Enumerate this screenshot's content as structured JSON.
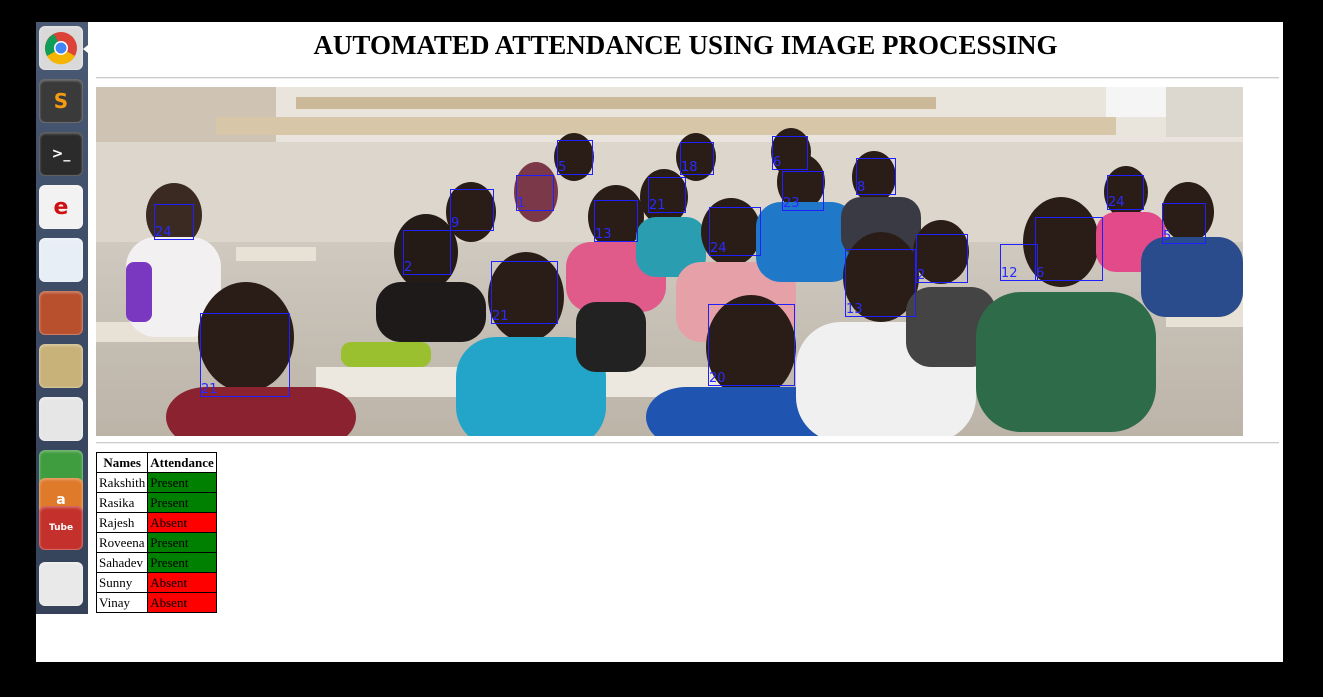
{
  "page": {
    "title": "AUTOMATED ATTENDANCE USING IMAGE PROCESSING"
  },
  "launcher": {
    "items": [
      {
        "name": "chrome-icon",
        "color": "#d9d9d9"
      },
      {
        "name": "sublime-text-icon",
        "label": "S",
        "color": "#3a3a3a"
      },
      {
        "name": "terminal-icon",
        "label": ">_",
        "color": "#2b2b2b"
      },
      {
        "name": "ubuntu-one-icon",
        "label": "e",
        "color": "#f2f2f2"
      },
      {
        "name": "image-viewer-icon",
        "color": "#e8eef6"
      },
      {
        "name": "files-icon",
        "color": "#b8502e"
      },
      {
        "name": "photo-tool-icon",
        "color": "#c9b27a"
      },
      {
        "name": "text-editor-icon",
        "color": "#e6e6e6"
      },
      {
        "name": "spreadsheet-icon",
        "color": "#3f9c3f"
      },
      {
        "name": "software-center-icon",
        "label": "a",
        "color": "#e07a2b"
      },
      {
        "name": "youtube-icon",
        "label": "Tube",
        "color": "#c4302b"
      },
      {
        "name": "gmail-icon",
        "color": "#e9e9e9"
      }
    ]
  },
  "detections": [
    "24",
    "21",
    "5",
    "9",
    "1",
    "2",
    "13",
    "18",
    "21",
    "6",
    "23",
    "24",
    "8",
    "13",
    "2",
    "12",
    "6",
    "24",
    "5",
    "20",
    "21"
  ],
  "table": {
    "headers": [
      "Names",
      "Attendance"
    ],
    "rows": [
      {
        "name": "Rakshith",
        "status": "Present"
      },
      {
        "name": "Rasika",
        "status": "Present"
      },
      {
        "name": "Rajesh",
        "status": "Absent"
      },
      {
        "name": "Roveena",
        "status": "Present"
      },
      {
        "name": "Sahadev",
        "status": "Present"
      },
      {
        "name": "Sunny",
        "status": "Absent"
      },
      {
        "name": "Vinay",
        "status": "Absent"
      }
    ]
  },
  "colors": {
    "present": "#008000",
    "absent": "#ff0000",
    "box": "#2020ff"
  }
}
